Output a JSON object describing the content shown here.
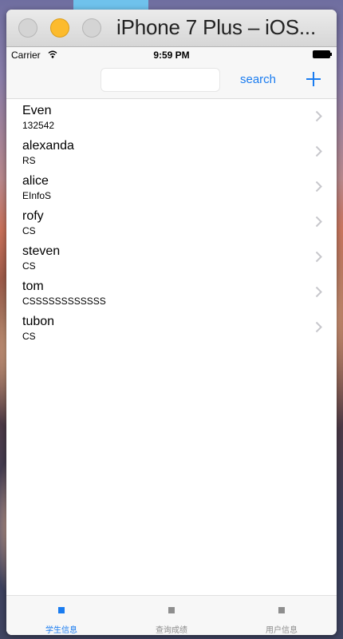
{
  "window": {
    "title": "iPhone 7 Plus – iOS..."
  },
  "status_bar": {
    "carrier": "Carrier",
    "time": "9:59 PM"
  },
  "nav": {
    "search_placeholder": "",
    "search_value": "",
    "search_label": "search",
    "add_icon": "plus-icon"
  },
  "students": [
    {
      "name": "Even",
      "detail": "132542"
    },
    {
      "name": "alexanda",
      "detail": "RS"
    },
    {
      "name": "alice",
      "detail": "EInfoS"
    },
    {
      "name": "rofy",
      "detail": "CS"
    },
    {
      "name": "steven",
      "detail": "CS"
    },
    {
      "name": "tom",
      "detail": "CSSSSSSSSSSSS"
    },
    {
      "name": "tubon",
      "detail": "CS"
    }
  ],
  "tabs": [
    {
      "label": "学生信息",
      "active": true
    },
    {
      "label": "查询成绩",
      "active": false
    },
    {
      "label": "用户信息",
      "active": false
    }
  ],
  "colors": {
    "accent": "#1a7cf0",
    "inactive_tab": "#8e8e8e",
    "minimize_button": "#fcbb2d"
  }
}
